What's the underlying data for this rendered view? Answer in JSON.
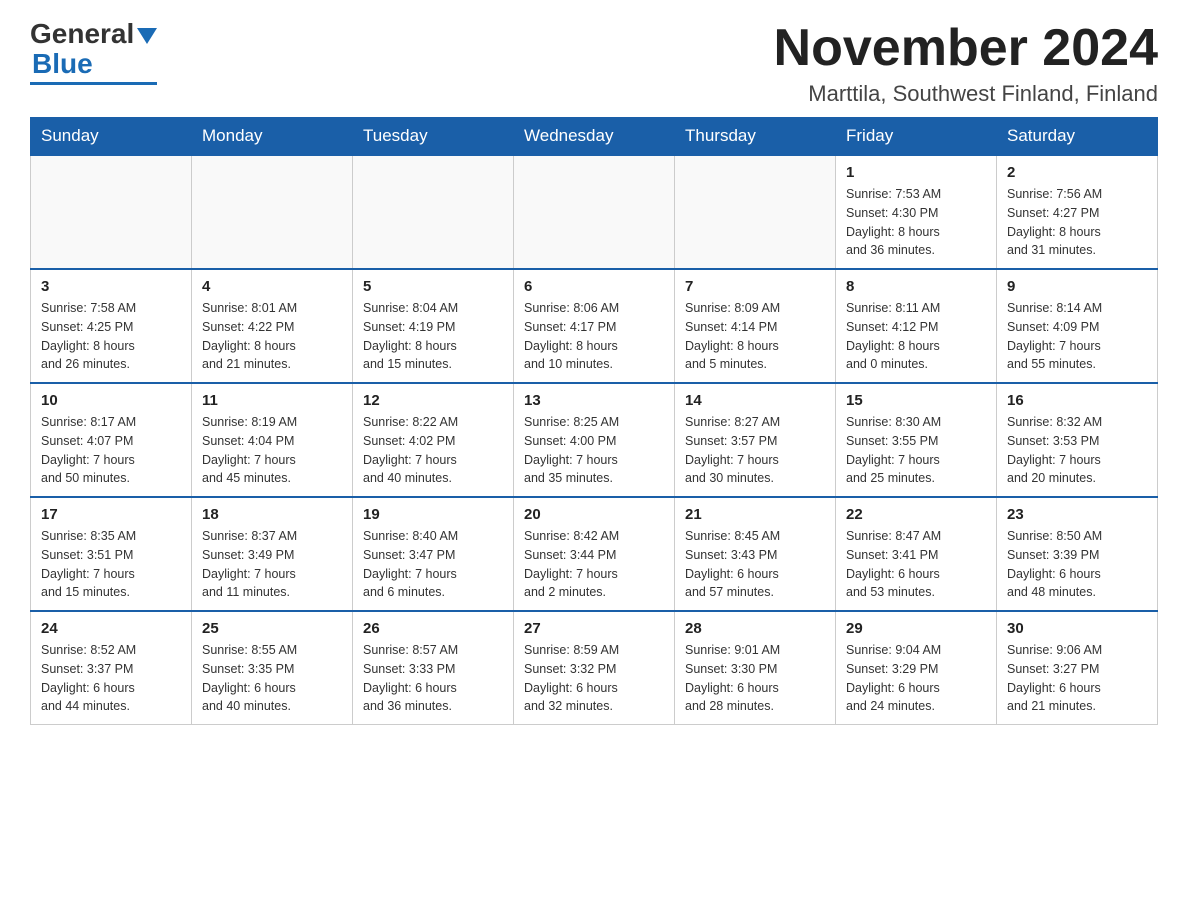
{
  "header": {
    "logo_text_general": "General",
    "logo_text_blue": "Blue",
    "month_title": "November 2024",
    "location": "Marttila, Southwest Finland, Finland"
  },
  "days_of_week": [
    "Sunday",
    "Monday",
    "Tuesday",
    "Wednesday",
    "Thursday",
    "Friday",
    "Saturday"
  ],
  "weeks": [
    [
      {
        "day": "",
        "info": ""
      },
      {
        "day": "",
        "info": ""
      },
      {
        "day": "",
        "info": ""
      },
      {
        "day": "",
        "info": ""
      },
      {
        "day": "",
        "info": ""
      },
      {
        "day": "1",
        "info": "Sunrise: 7:53 AM\nSunset: 4:30 PM\nDaylight: 8 hours\nand 36 minutes."
      },
      {
        "day": "2",
        "info": "Sunrise: 7:56 AM\nSunset: 4:27 PM\nDaylight: 8 hours\nand 31 minutes."
      }
    ],
    [
      {
        "day": "3",
        "info": "Sunrise: 7:58 AM\nSunset: 4:25 PM\nDaylight: 8 hours\nand 26 minutes."
      },
      {
        "day": "4",
        "info": "Sunrise: 8:01 AM\nSunset: 4:22 PM\nDaylight: 8 hours\nand 21 minutes."
      },
      {
        "day": "5",
        "info": "Sunrise: 8:04 AM\nSunset: 4:19 PM\nDaylight: 8 hours\nand 15 minutes."
      },
      {
        "day": "6",
        "info": "Sunrise: 8:06 AM\nSunset: 4:17 PM\nDaylight: 8 hours\nand 10 minutes."
      },
      {
        "day": "7",
        "info": "Sunrise: 8:09 AM\nSunset: 4:14 PM\nDaylight: 8 hours\nand 5 minutes."
      },
      {
        "day": "8",
        "info": "Sunrise: 8:11 AM\nSunset: 4:12 PM\nDaylight: 8 hours\nand 0 minutes."
      },
      {
        "day": "9",
        "info": "Sunrise: 8:14 AM\nSunset: 4:09 PM\nDaylight: 7 hours\nand 55 minutes."
      }
    ],
    [
      {
        "day": "10",
        "info": "Sunrise: 8:17 AM\nSunset: 4:07 PM\nDaylight: 7 hours\nand 50 minutes."
      },
      {
        "day": "11",
        "info": "Sunrise: 8:19 AM\nSunset: 4:04 PM\nDaylight: 7 hours\nand 45 minutes."
      },
      {
        "day": "12",
        "info": "Sunrise: 8:22 AM\nSunset: 4:02 PM\nDaylight: 7 hours\nand 40 minutes."
      },
      {
        "day": "13",
        "info": "Sunrise: 8:25 AM\nSunset: 4:00 PM\nDaylight: 7 hours\nand 35 minutes."
      },
      {
        "day": "14",
        "info": "Sunrise: 8:27 AM\nSunset: 3:57 PM\nDaylight: 7 hours\nand 30 minutes."
      },
      {
        "day": "15",
        "info": "Sunrise: 8:30 AM\nSunset: 3:55 PM\nDaylight: 7 hours\nand 25 minutes."
      },
      {
        "day": "16",
        "info": "Sunrise: 8:32 AM\nSunset: 3:53 PM\nDaylight: 7 hours\nand 20 minutes."
      }
    ],
    [
      {
        "day": "17",
        "info": "Sunrise: 8:35 AM\nSunset: 3:51 PM\nDaylight: 7 hours\nand 15 minutes."
      },
      {
        "day": "18",
        "info": "Sunrise: 8:37 AM\nSunset: 3:49 PM\nDaylight: 7 hours\nand 11 minutes."
      },
      {
        "day": "19",
        "info": "Sunrise: 8:40 AM\nSunset: 3:47 PM\nDaylight: 7 hours\nand 6 minutes."
      },
      {
        "day": "20",
        "info": "Sunrise: 8:42 AM\nSunset: 3:44 PM\nDaylight: 7 hours\nand 2 minutes."
      },
      {
        "day": "21",
        "info": "Sunrise: 8:45 AM\nSunset: 3:43 PM\nDaylight: 6 hours\nand 57 minutes."
      },
      {
        "day": "22",
        "info": "Sunrise: 8:47 AM\nSunset: 3:41 PM\nDaylight: 6 hours\nand 53 minutes."
      },
      {
        "day": "23",
        "info": "Sunrise: 8:50 AM\nSunset: 3:39 PM\nDaylight: 6 hours\nand 48 minutes."
      }
    ],
    [
      {
        "day": "24",
        "info": "Sunrise: 8:52 AM\nSunset: 3:37 PM\nDaylight: 6 hours\nand 44 minutes."
      },
      {
        "day": "25",
        "info": "Sunrise: 8:55 AM\nSunset: 3:35 PM\nDaylight: 6 hours\nand 40 minutes."
      },
      {
        "day": "26",
        "info": "Sunrise: 8:57 AM\nSunset: 3:33 PM\nDaylight: 6 hours\nand 36 minutes."
      },
      {
        "day": "27",
        "info": "Sunrise: 8:59 AM\nSunset: 3:32 PM\nDaylight: 6 hours\nand 32 minutes."
      },
      {
        "day": "28",
        "info": "Sunrise: 9:01 AM\nSunset: 3:30 PM\nDaylight: 6 hours\nand 28 minutes."
      },
      {
        "day": "29",
        "info": "Sunrise: 9:04 AM\nSunset: 3:29 PM\nDaylight: 6 hours\nand 24 minutes."
      },
      {
        "day": "30",
        "info": "Sunrise: 9:06 AM\nSunset: 3:27 PM\nDaylight: 6 hours\nand 21 minutes."
      }
    ]
  ]
}
